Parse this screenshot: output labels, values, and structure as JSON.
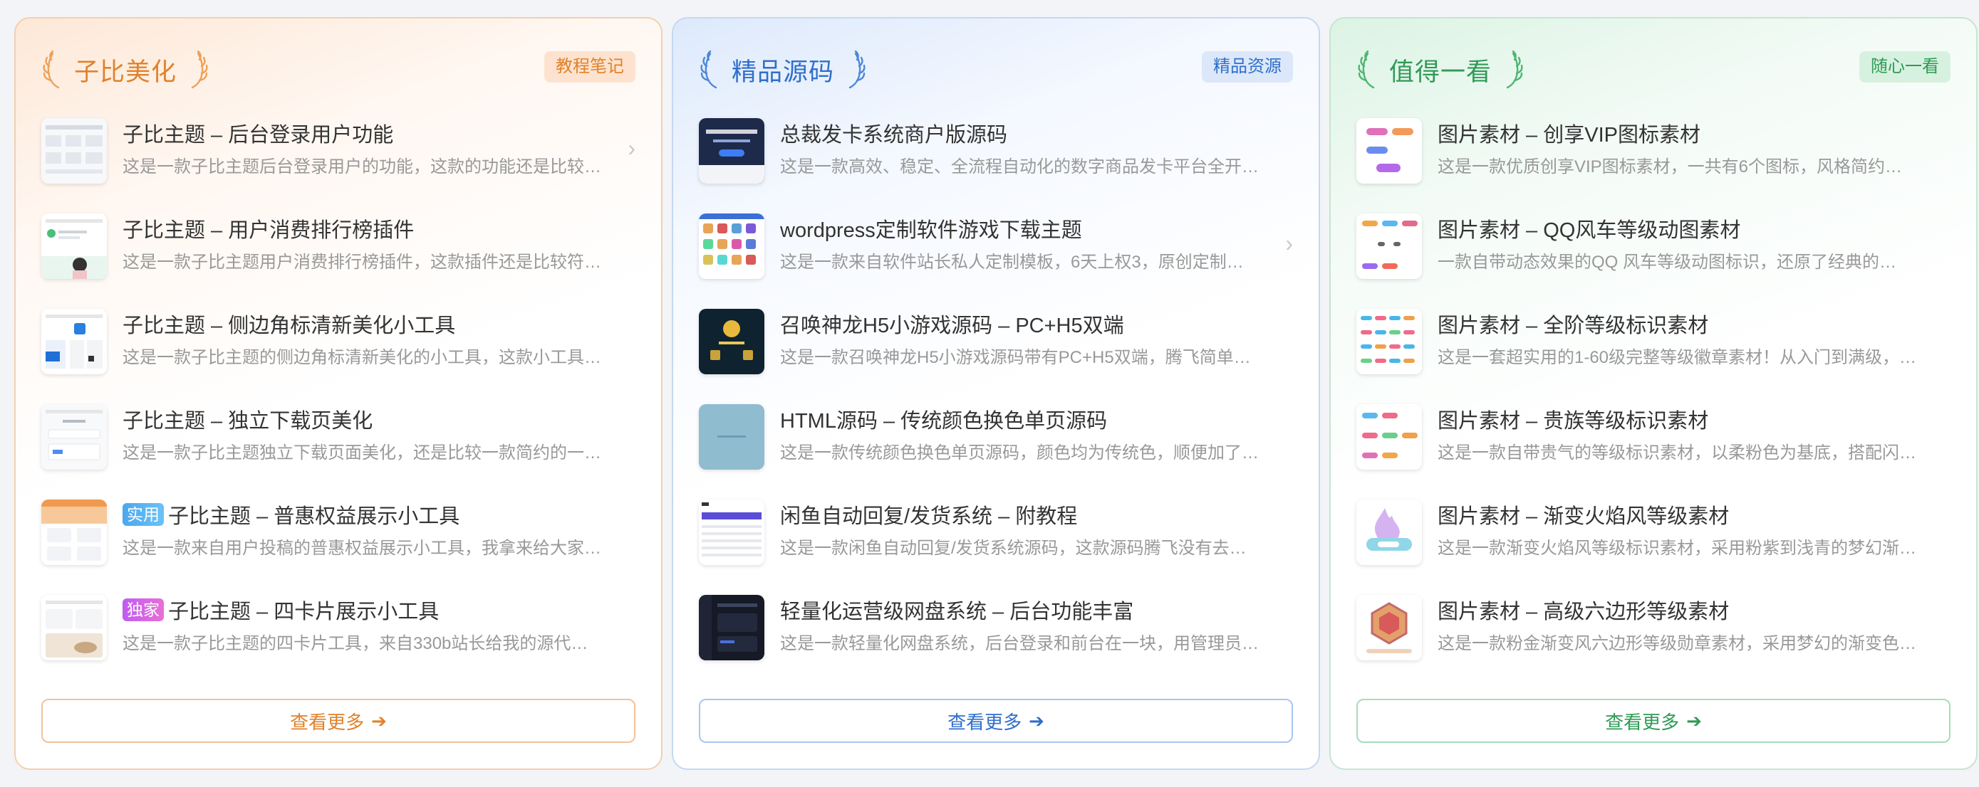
{
  "columns": [
    {
      "title": "子比美化",
      "tag": "教程笔记",
      "more": "查看更多",
      "items": [
        {
          "title": "子比主题 – 后台登录用户功能",
          "desc": "这是一款子比主题后台登录用户的功能，这款的功能还是比较…",
          "badge": ""
        },
        {
          "title": "子比主题 – 用户消费排行榜插件",
          "desc": "这是一款子比主题用户消费排行榜插件，这款插件还是比较符…",
          "badge": ""
        },
        {
          "title": "子比主题 – 侧边角标清新美化小工具",
          "desc": "这是一款子比主题的侧边角标清新美化的小工具，这款小工具…",
          "badge": ""
        },
        {
          "title": "子比主题 – 独立下载页美化",
          "desc": "这是一款子比主题独立下载页面美化，还是比较一款简约的一…",
          "badge": ""
        },
        {
          "title": "子比主题 – 普惠权益展示小工具",
          "desc": "这是一款来自用户投稿的普惠权益展示小工具，我拿来给大家…",
          "badge": "实用"
        },
        {
          "title": "子比主题 – 四卡片展示小工具",
          "desc": "这是一款子比主题的四卡片工具，来自330b站长给我的源代…",
          "badge": "独家"
        }
      ]
    },
    {
      "title": "精品源码",
      "tag": "精品资源",
      "more": "查看更多",
      "items": [
        {
          "title": "总裁发卡系统商户版源码",
          "desc": "这是一款高效、稳定、全流程自动化的数字商品发卡平台全开…",
          "badge": ""
        },
        {
          "title": "wordpress定制软件游戏下载主题",
          "desc": "这是一款来自软件站长私人定制模板，6天上权3，原创定制…",
          "badge": ""
        },
        {
          "title": "召唤神龙H5小游戏源码 – PC+H5双端",
          "desc": "这是一款召唤神龙H5小游戏源码带有PC+H5双端，腾飞简单…",
          "badge": ""
        },
        {
          "title": "HTML源码 – 传统颜色换色单页源码",
          "desc": "这是一款传统颜色换色单页源码，颜色均为传统色，顺便加了…",
          "badge": ""
        },
        {
          "title": "闲鱼自动回复/发货系统 – 附教程",
          "desc": "这是一款闲鱼自动回复/发货系统源码，这款源码腾飞没有去…",
          "badge": ""
        },
        {
          "title": "轻量化运营级网盘系统 – 后台功能丰富",
          "desc": "这是一款轻量化网盘系统，后台登录和前台在一块，用管理员…",
          "badge": ""
        }
      ]
    },
    {
      "title": "值得一看",
      "tag": "随心一看",
      "more": "查看更多",
      "items": [
        {
          "title": "图片素材 – 创享VIP图标素材",
          "desc": "这是一款优质创享VIP图标素材，一共有6个图标，风格简约…",
          "badge": ""
        },
        {
          "title": "图片素材 – QQ风车等级动图素材",
          "desc": "一款自带动态效果的QQ 风车等级动图标识，还原了经典的…",
          "badge": ""
        },
        {
          "title": "图片素材 – 全阶等级标识素材",
          "desc": "这是一套超实用的1-60级完整等级徽章素材！从入门到满级，…",
          "badge": ""
        },
        {
          "title": "图片素材 – 贵族等级标识素材",
          "desc": "这是一款自带贵气的等级标识素材，以柔粉色为基底，搭配闪…",
          "badge": ""
        },
        {
          "title": "图片素材 – 渐变火焰风等级素材",
          "desc": "这是一款渐变火焰风等级标识素材，采用粉紫到浅青的梦幻渐…",
          "badge": ""
        },
        {
          "title": "图片素材 – 高级六边形等级素材",
          "desc": "这是一款粉金渐变风六边形等级勋章素材，采用梦幻的渐变色…",
          "badge": ""
        }
      ]
    }
  ],
  "colors": {
    "orange": "#e0822c",
    "blue": "#2f6fcc",
    "green": "#2f9a56"
  },
  "icons": {
    "laurel": "laurel-icon",
    "arrow": "arrow-right-icon",
    "chevron": "chevron-right-icon"
  }
}
